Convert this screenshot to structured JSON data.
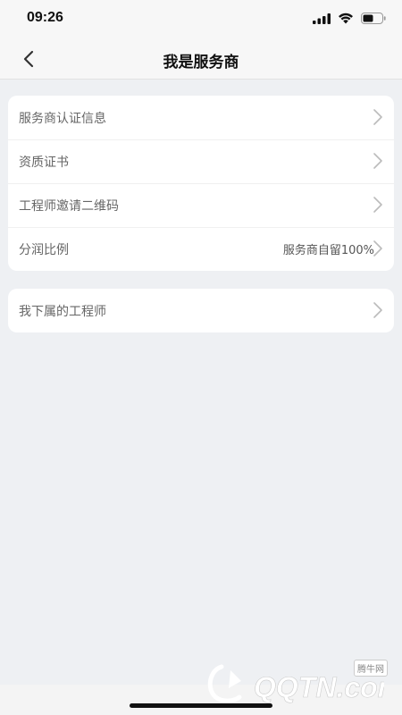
{
  "status": {
    "time": "09:26"
  },
  "nav": {
    "title": "我是服务商"
  },
  "group1": [
    {
      "label": "服务商认证信息",
      "value": ""
    },
    {
      "label": "资质证书",
      "value": ""
    },
    {
      "label": "工程师邀请二维码",
      "value": ""
    },
    {
      "label": "分润比例",
      "value": "服务商自留100%"
    }
  ],
  "group2": [
    {
      "label": "我下属的工程师",
      "value": ""
    }
  ],
  "watermark": {
    "badge": "腾牛网",
    "logo": "QQTN.com"
  },
  "icons": {
    "back": "chevron-left-icon",
    "row": "chevron-right-icon",
    "signal": "signal-icon",
    "wifi": "wifi-icon",
    "battery": "battery-icon"
  }
}
